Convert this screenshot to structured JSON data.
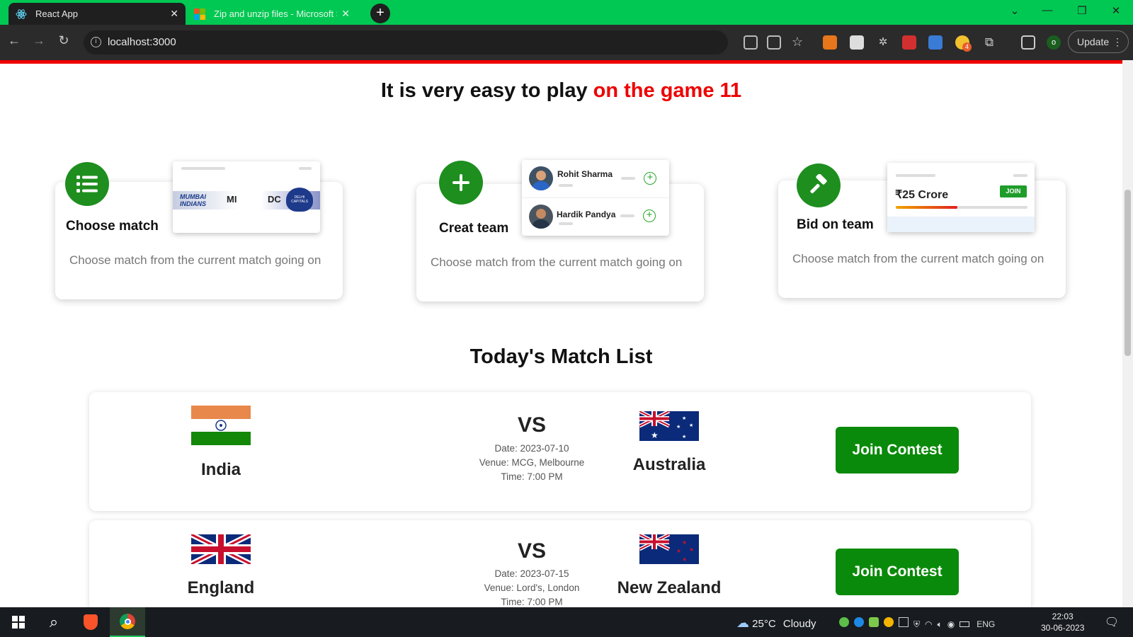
{
  "browser": {
    "tabs": [
      {
        "title": "React App",
        "active": true
      },
      {
        "title": "Zip and unzip files - Microsoft S",
        "active": false
      }
    ],
    "new_tab": "+",
    "url": "localhost:3000",
    "update_label": "Update",
    "profile_initial": "o",
    "extension_badge": "4",
    "window_controls": [
      "chevron-down-icon",
      "minimize-icon",
      "restore-icon",
      "close-icon"
    ],
    "colors": {
      "tab_strip": "#00c853",
      "toolbar": "#2b2b2b"
    }
  },
  "hero": {
    "title_prefix": "It is very easy to play ",
    "title_highlight": "on the game 11",
    "highlight_color": "#e00000"
  },
  "steps": [
    {
      "label": "Choose match",
      "icon": "list-icon",
      "description": "Choose match from the current match going on",
      "preview": {
        "team1": "MI",
        "team2": "DC",
        "team1_logo": "MUMBAI INDIANS",
        "team2_logo": "DELHI CAPITALS"
      }
    },
    {
      "label": "Creat team",
      "icon": "plus-icon",
      "description": "Choose match from the current match going on",
      "preview": {
        "players": [
          "Rohit Sharma",
          "Hardik Pandya"
        ]
      }
    },
    {
      "label": "Bid on team",
      "icon": "gavel-icon",
      "description": "Choose match from the current match going on",
      "preview": {
        "amount": "₹25 Crore",
        "join_label": "JOIN",
        "progress": 0.47
      }
    }
  ],
  "match_list": {
    "title": "Today's Match List",
    "vs_label": "VS",
    "join_label": "Join Contest",
    "matches": [
      {
        "team1": "India",
        "team2": "Australia",
        "date": "Date: 2023-07-10",
        "venue": "Venue: MCG, Melbourne",
        "time": "Time: 7:00 PM"
      },
      {
        "team1": "England",
        "team2": "New Zealand",
        "date": "Date: 2023-07-15",
        "venue": "Venue: Lord's, London",
        "time": "Time: 7:00 PM"
      }
    ],
    "accent_color": "#0a8a0a"
  },
  "taskbar": {
    "weather_temp": "25°C",
    "weather_desc": "Cloudy",
    "language": "ENG",
    "time": "22:03",
    "date": "30-06-2023"
  }
}
